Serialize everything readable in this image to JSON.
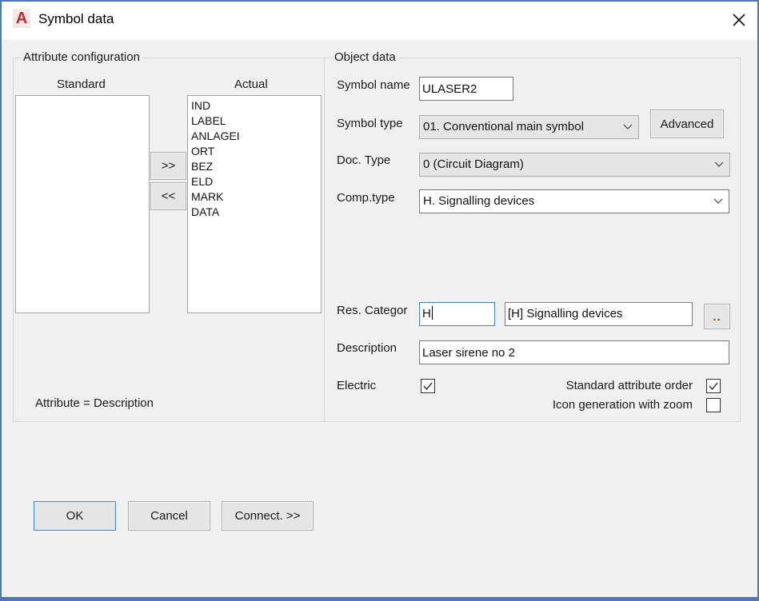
{
  "window": {
    "title": "Symbol data",
    "app_icon": "autocad-logo-icon",
    "app_icon_glyph": "A",
    "close_icon": "close-icon"
  },
  "attribute_config": {
    "group_label": "Attribute configuration",
    "standard_label": "Standard",
    "actual_label": "Actual",
    "standard_items": [],
    "actual_items": [
      "IND",
      "LABEL",
      "ANLAGEI",
      "ORT",
      "BEZ",
      "ELD",
      "MARK",
      "DATA"
    ],
    "move_right_label": ">>",
    "move_left_label": "<<",
    "attribute_hint": "Attribute = Description"
  },
  "object_data": {
    "group_label": "Object data",
    "symbol_name_label": "Symbol name",
    "symbol_name_value": "ULASER2",
    "symbol_type_label": "Symbol type",
    "symbol_type_value": "01. Conventional main symbol",
    "advanced_label": "Advanced",
    "doc_type_label": "Doc. Type",
    "doc_type_value": "0 (Circuit Diagram)",
    "comp_type_label": "Comp.type",
    "comp_type_value": "H. Signalling devices",
    "res_category_label": "Res. Categor",
    "res_category_value": "H",
    "res_category_text": "[H] Signalling devices",
    "browse_label": "..",
    "description_label": "Description",
    "description_value": "Laser sirene no 2",
    "electric_label": "Electric",
    "electric_checked": true,
    "standard_attr_order_label": "Standard attribute order",
    "standard_attr_order_checked": true,
    "icon_generation_label": "Icon generation with zoom",
    "icon_generation_checked": false
  },
  "footer": {
    "ok_label": "OK",
    "cancel_label": "Cancel",
    "connect_label": "Connect. >>"
  },
  "colors": {
    "window_border": "#4a7ab5",
    "dialog_bg": "#f0f0f0",
    "focus_blue": "#3a84d0",
    "app_icon_red": "#c4262e"
  }
}
